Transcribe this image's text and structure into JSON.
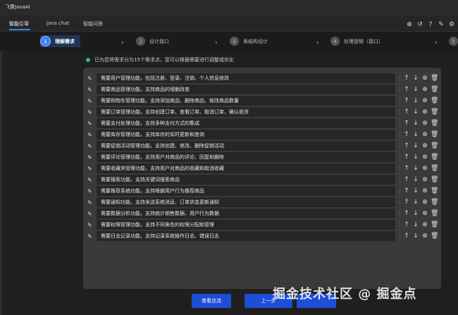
{
  "app": {
    "title": "飞算JavaAI"
  },
  "tabs": [
    {
      "label": "智能引导"
    },
    {
      "label": "Java chat"
    },
    {
      "label": "智能问答"
    }
  ],
  "toolbar_icons": [
    "add-icon",
    "history-icon",
    "help-icon",
    "edit-icon",
    "settings-icon"
  ],
  "steps": [
    {
      "num": "1",
      "label": "理解需求"
    },
    {
      "num": "2",
      "label": "设计接口"
    },
    {
      "num": "3",
      "label": "表结构设计"
    },
    {
      "num": "4",
      "label": "处理逻辑（接口）"
    },
    {
      "num": "5",
      "label": ""
    }
  ],
  "info_text": "已为您将需求分为15个需求点，您可以根据需要进行调整或优化",
  "requirements": [
    "需要用户管理功能，包括注册、登录、注销、个人信息修改",
    "需要商品管理功能，支持商品的增删改查",
    "需要购物车管理功能，支持添加商品、删除商品、修改商品数量",
    "需要订单管理功能，支持创建订单、查看订单、取消订单、确认收货",
    "需要支付处理功能，支持多种支付方式的集成",
    "需要库存管理功能，支持库存的实时更新和查询",
    "需要促销活动管理功能，支持创建、修改、删除促销活动",
    "需要评论管理功能，支持用户对商品的评论、回复和删除",
    "需要收藏夹管理功能，支持用户对商品的收藏和取消收藏",
    "需要搜索功能，支持关键词搜索商品",
    "需要推荐系统功能，支持根据用户行为推荐商品",
    "需要通知功能，支持发送系统消息、订单状态更新通知",
    "需要数据分析功能，支持统计销售数据、用户行为数据",
    "需要权限管理功能，支持不同角色的权限分配和管理",
    "需要日志记录功能，支持记录系统操作日志、错误日志"
  ],
  "buttons": {
    "view_flow": "查看总流",
    "prev": "上一步"
  },
  "watermark": "掘金技术社区 @ 掘金点"
}
